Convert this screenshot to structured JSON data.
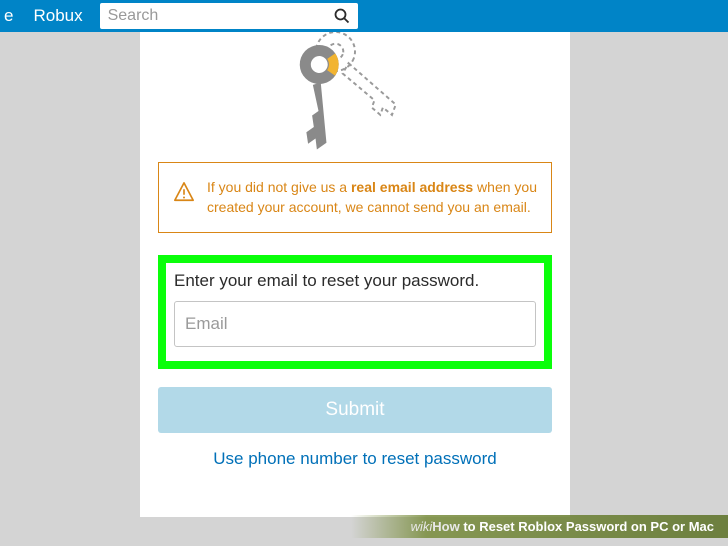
{
  "nav": {
    "item_partial": "e",
    "robux": "Robux",
    "search_placeholder": "Search"
  },
  "alert": {
    "pre": "If you did not give us a ",
    "bold": "real email address",
    "post": " when you created your account, we cannot send you an email."
  },
  "form": {
    "prompt": "Enter your email to reset your password.",
    "email_placeholder": "Email",
    "submit": "Submit",
    "phone_link": "Use phone number to reset password"
  },
  "wikihow": {
    "wiki": "wiki",
    "how": "How",
    "title": " to Reset Roblox Password on PC or Mac"
  }
}
